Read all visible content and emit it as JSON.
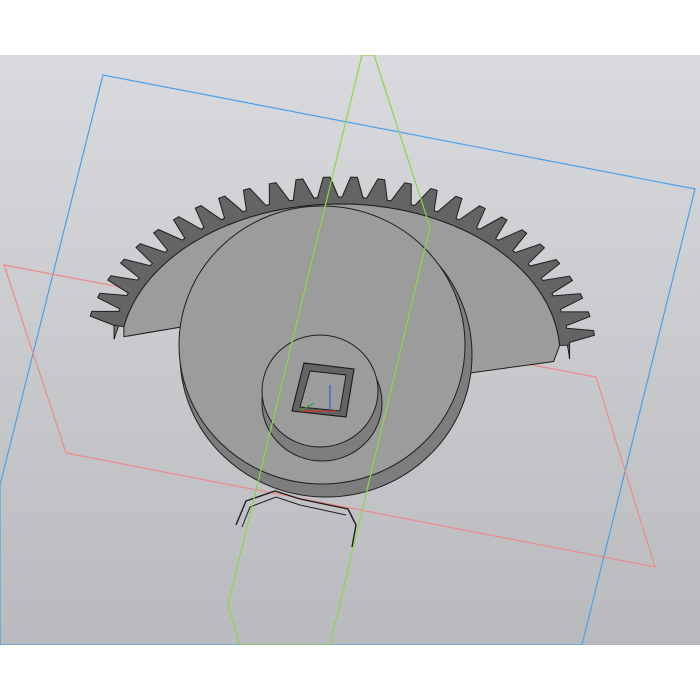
{
  "scene": {
    "description_hidden": "",
    "colors": {
      "background_top": "#d9dadd",
      "background_bottom": "#b9babd",
      "part_face": "#9c9c9c",
      "part_side": "#7d7d7d",
      "part_dark": "#646464",
      "edge": "#1e1e1e",
      "plane_xy": "#f08a8a",
      "plane_yz": "#8ad64a",
      "plane_zx": "#4aa0ea",
      "axis_x": "#d03030",
      "axis_y": "#30a030",
      "axis_z": "#3060d0"
    },
    "objects": {
      "model": "gear-sector-with-hub",
      "planes": [
        "XY",
        "YZ",
        "ZX"
      ],
      "features": [
        "gear-teeth",
        "sector-plate",
        "round-hub",
        "square-bore",
        "notch"
      ]
    }
  }
}
